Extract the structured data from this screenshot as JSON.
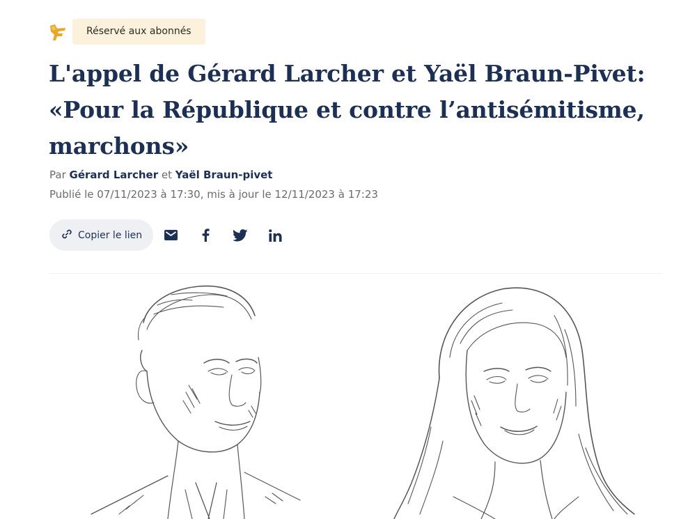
{
  "premium": {
    "logo_icon": "le-figaro-f-logo-icon",
    "badge_label": "Réservé aux abonnés"
  },
  "article": {
    "title": "L'appel de Gérard Larcher et Yaël Braun-Pivet: «Pour la République et contre l’antisémitisme, marchons»",
    "byline_prefix": "Par",
    "author_1": "Gérard Larcher",
    "byline_join": "et",
    "author_2": "Yaël Braun-pivet",
    "dates": "Publié le 07/11/2023 à 17:30, mis à jour le 12/11/2023 à 17:23"
  },
  "share": {
    "copy_link_label": "Copier le lien",
    "icons": [
      "link-icon",
      "mail-icon",
      "facebook-icon",
      "twitter-icon",
      "linkedin-icon"
    ]
  },
  "colors": {
    "title": "#1c3055",
    "badge_bg": "#fcf2dc",
    "logo": "#e8a824",
    "meta_gray": "#6b6b6b",
    "button_bg": "#eef0f4"
  }
}
